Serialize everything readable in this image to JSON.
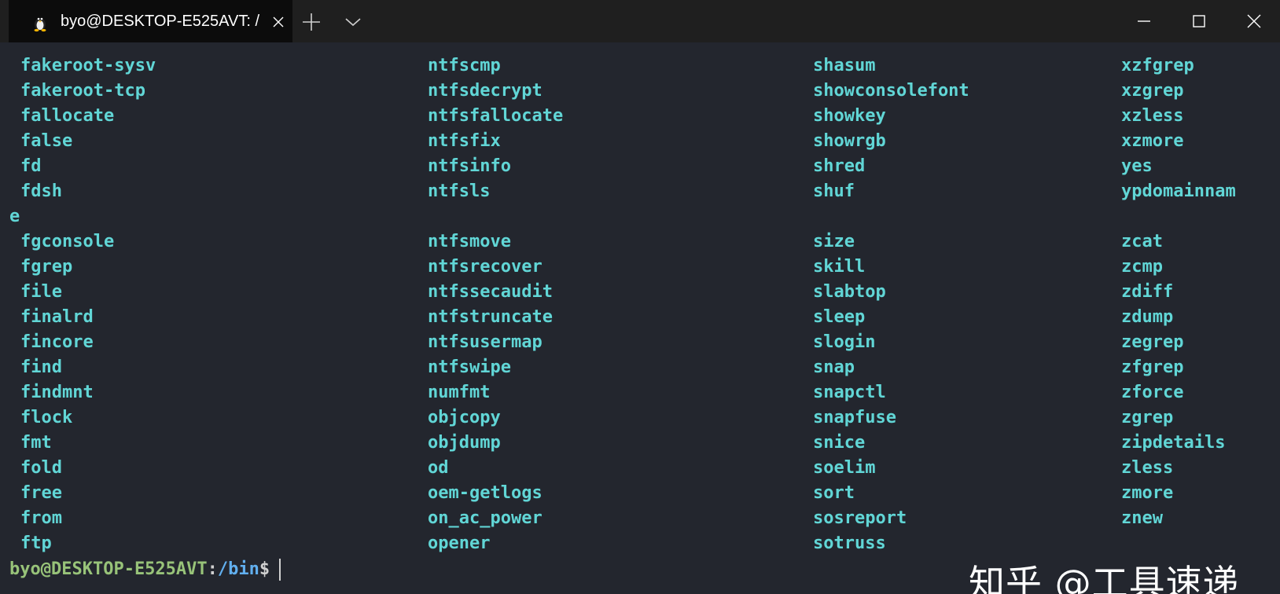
{
  "titlebar": {
    "tab_title": "byo@DESKTOP-E525AVT: /",
    "tab_icon": "linux-penguin-icon",
    "close_tab_icon": "close-icon",
    "new_tab_icon": "plus-icon",
    "dropdown_icon": "chevron-down-icon"
  },
  "window_controls": {
    "minimize_icon": "minimize-icon",
    "maximize_icon": "maximize-icon",
    "close_icon": "close-icon"
  },
  "terminal": {
    "colors": {
      "background": "#23262e",
      "listing": "#61d6d6",
      "prompt_user": "#98c379",
      "prompt_path": "#61afef"
    },
    "columns": [
      [
        "fakeroot-sysv",
        "fakeroot-tcp",
        "fallocate",
        "false",
        "fd",
        "fdsh",
        "",
        "fgconsole",
        "fgrep",
        "file",
        "finalrd",
        "fincore",
        "find",
        "findmnt",
        "flock",
        "fmt",
        "fold",
        "free",
        "from",
        "ftp"
      ],
      [
        "ntfscmp",
        "ntfsdecrypt",
        "ntfsfallocate",
        "ntfsfix",
        "ntfsinfo",
        "ntfsls",
        "",
        "ntfsmove",
        "ntfsrecover",
        "ntfssecaudit",
        "ntfstruncate",
        "ntfsusermap",
        "ntfswipe",
        "numfmt",
        "objcopy",
        "objdump",
        "od",
        "oem-getlogs",
        "on_ac_power",
        "opener"
      ],
      [
        "shasum",
        "showconsolefont",
        "showkey",
        "showrgb",
        "shred",
        "shuf",
        "",
        "size",
        "skill",
        "slabtop",
        "sleep",
        "slogin",
        "snap",
        "snapctl",
        "snapfuse",
        "snice",
        "soelim",
        "sort",
        "sosreport",
        "sotruss"
      ],
      [
        "xzfgrep",
        "xzgrep",
        "xzless",
        "xzmore",
        "yes",
        "ypdomainnam",
        "",
        "zcat",
        "zcmp",
        "zdiff",
        "zdump",
        "zegrep",
        "zfgrep",
        "zforce",
        "zgrep",
        "zipdetails",
        "zless",
        "zmore",
        "znew",
        ""
      ]
    ],
    "wrapped_char": "e",
    "prompt": {
      "user_host": "byo@DESKTOP-E525AVT",
      "colon": ":",
      "path": "/bin",
      "symbol": "$"
    }
  },
  "watermark": "知乎 @工具速递"
}
